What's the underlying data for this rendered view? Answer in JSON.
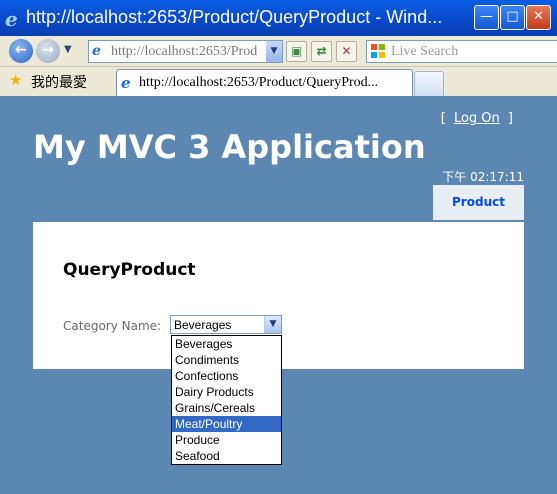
{
  "window": {
    "title": "http://localhost:2653/Product/QueryProduct - Wind...",
    "min_glyph": "—",
    "max_glyph": "□",
    "close_glyph": "✕"
  },
  "addressbar": {
    "url": "http://localhost:2653/Product/QueryProduct",
    "search_placeholder": "Live Search"
  },
  "favorites": {
    "label": "我的最愛"
  },
  "tab": {
    "title": "http://localhost:2653/Product/QueryProd..."
  },
  "page": {
    "login": {
      "open_bracket": "[",
      "link": "Log On",
      "close_bracket": "]"
    },
    "app_title": "My MVC 3 Application",
    "time": "下午 02:17:11",
    "menu": [
      {
        "label": "Product"
      }
    ],
    "heading": "QueryProduct",
    "category_label": "Category Name:",
    "selected": "Beverages",
    "options": [
      "Beverages",
      "Condiments",
      "Confections",
      "Dairy Products",
      "Grains/Cereals",
      "Meat/Poultry",
      "Produce",
      "Seafood"
    ],
    "highlighted_index": 5
  },
  "colors": {
    "page_bg": "#5c87b2",
    "highlight": "#316ac5",
    "menu_text": "#034af3"
  }
}
